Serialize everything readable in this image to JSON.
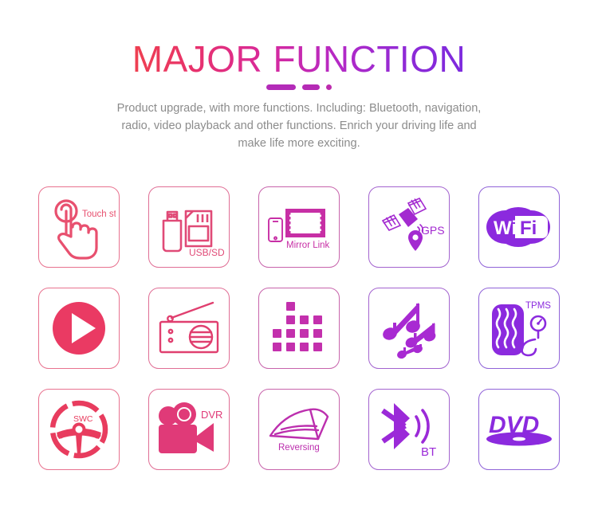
{
  "header": {
    "title": "MAJOR FUNCTION",
    "subtitle": "Product upgrade, with more functions. Including: Bluetooth, navigation, radio, video playback and other functions. Enrich your driving life and make life more exciting."
  },
  "colors": {
    "title_gradient_start": "#ef4050",
    "title_gradient_end": "#7c2ade",
    "divider": "#b32bb8",
    "subtitle": "#8c8c8c",
    "row1_pink": "#e24a72",
    "row_purple": "#8f2ad6",
    "background": "#ffffff"
  },
  "features": [
    {
      "id": "touch-style",
      "icon": "touch-hand-icon",
      "label": "Touch style",
      "color": "#e8506f",
      "border": "#e8728f"
    },
    {
      "id": "usb-sd",
      "icon": "usb-sd-card-icon",
      "label": "USB/SD",
      "color": "#e04a77",
      "border": "#e06e95"
    },
    {
      "id": "mirror-link",
      "icon": "mirror-link-icon",
      "label": "Mirror Link",
      "color": "#c72fa5",
      "border": "#c763ab"
    },
    {
      "id": "gps",
      "icon": "satellite-gps-icon",
      "label": "GPS",
      "color": "#a32ad0",
      "border": "#a363cf"
    },
    {
      "id": "wifi",
      "icon": "wifi-logo-icon",
      "label": "WiFi",
      "color": "#8b2ade",
      "border": "#9063d8"
    },
    {
      "id": "video-play",
      "icon": "play-circle-icon",
      "label": "",
      "color": "#ea3a63",
      "border": "#e8728f"
    },
    {
      "id": "radio",
      "icon": "radio-icon",
      "label": "",
      "color": "#e03f6f",
      "border": "#e06e95"
    },
    {
      "id": "equalizer",
      "icon": "equalizer-dots-icon",
      "label": "",
      "color": "#c330ad",
      "border": "#c763ab"
    },
    {
      "id": "music",
      "icon": "music-notes-icon",
      "label": "",
      "color": "#a82ad2",
      "border": "#a363cf"
    },
    {
      "id": "tpms",
      "icon": "tire-pressure-icon",
      "label": "TPMS",
      "color": "#8b2ade",
      "border": "#9063d8"
    },
    {
      "id": "swc",
      "icon": "steering-wheel-icon",
      "label": "SWC",
      "color": "#e83c5e",
      "border": "#e8728f"
    },
    {
      "id": "dvr",
      "icon": "video-camera-icon",
      "label": "DVR",
      "color": "#e03a78",
      "border": "#e06e95"
    },
    {
      "id": "reversing",
      "icon": "reversing-lines-icon",
      "label": "Reversing",
      "color": "#bc2fae",
      "border": "#c763ab"
    },
    {
      "id": "bluetooth",
      "icon": "bluetooth-icon",
      "label": "BT",
      "color": "#9b2ad8",
      "border": "#a363cf"
    },
    {
      "id": "dvd",
      "icon": "dvd-logo-icon",
      "label": "DVD",
      "color": "#8b2ade",
      "border": "#9063d8"
    }
  ]
}
